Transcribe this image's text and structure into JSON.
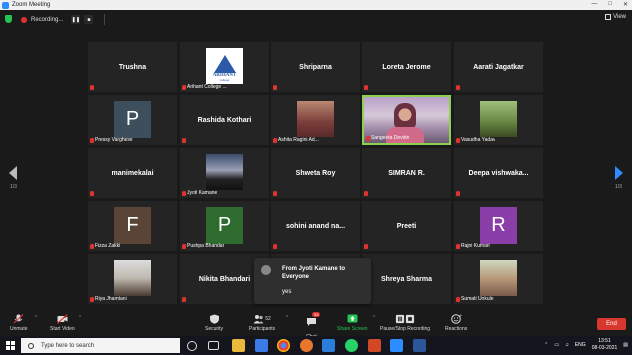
{
  "window": {
    "title": "Zoom Meeting"
  },
  "recording": {
    "label": "Recording..."
  },
  "view_button": {
    "label": "View"
  },
  "pages": {
    "left": "1/3",
    "right": "1/3"
  },
  "participants": [
    {
      "name": "Trushna",
      "label": "",
      "kind": "name"
    },
    {
      "name": "",
      "label": "Arihant College ...",
      "kind": "logo",
      "logo_text": "ARIHANT",
      "logo_sub": "college"
    },
    {
      "name": "Shriparna",
      "label": "",
      "kind": "name"
    },
    {
      "name": "Loreta Jerome",
      "label": "",
      "kind": "name"
    },
    {
      "name": "Aarati Jagatkar",
      "label": "",
      "kind": "name"
    },
    {
      "name": "",
      "label": "Pressy Varghese",
      "kind": "avatar",
      "initial": "P",
      "avatar_color": "#3d4f5c"
    },
    {
      "name": "Rashida Kothari",
      "label": "",
      "kind": "name"
    },
    {
      "name": "",
      "label": "Ashita Ragini Ad...",
      "kind": "photo"
    },
    {
      "name": "",
      "label": "Sangeeta Devidn",
      "kind": "video"
    },
    {
      "name": "",
      "label": "Vasudha Yadav",
      "kind": "photo"
    },
    {
      "name": "manimekalai",
      "label": "",
      "kind": "name"
    },
    {
      "name": "",
      "label": "Jyoti Kamane",
      "kind": "photo"
    },
    {
      "name": "Shweta Roy",
      "label": "",
      "kind": "name"
    },
    {
      "name": "SIMRAN R.",
      "label": "",
      "kind": "name"
    },
    {
      "name": "Deepa  vishwaka...",
      "label": "",
      "kind": "name"
    },
    {
      "name": "",
      "label": "Fizza Zakki",
      "kind": "avatar",
      "initial": "F",
      "avatar_color": "#5a4436"
    },
    {
      "name": "",
      "label": "Pushpa Bhandar",
      "kind": "avatar",
      "initial": "P",
      "avatar_color": "#2e6b2e"
    },
    {
      "name": "sohini anand na...",
      "label": "",
      "kind": "name"
    },
    {
      "name": "Preeti",
      "label": "",
      "kind": "name"
    },
    {
      "name": "",
      "label": "Rajni Kumari",
      "kind": "avatar",
      "initial": "R",
      "avatar_color": "#8a3fa8"
    },
    {
      "name": "",
      "label": "Riya Jhamtani",
      "kind": "photo"
    },
    {
      "name": "Nikita Bhandari",
      "label": "",
      "kind": "name"
    },
    {
      "name": "",
      "label": "",
      "kind": "hidden"
    },
    {
      "name": "Shreya Sharma",
      "label": "",
      "kind": "name"
    },
    {
      "name": "",
      "label": "Sumati Unkule",
      "kind": "photo"
    }
  ],
  "chat_popup": {
    "from": "From Jyoti Kamane to Everyone",
    "message": "yes"
  },
  "toolbar": {
    "unmute": "Unmute",
    "start_video": "Start Video",
    "security": "Security",
    "participants": "Participants",
    "participants_count": "52",
    "chat": "Chat",
    "chat_badge": "33",
    "share_screen": "Share Screen",
    "record": "Pause/Stop Recording",
    "reactions": "Reactions",
    "end": "End"
  },
  "taskbar": {
    "search_placeholder": "Type here to search",
    "language": "ENG",
    "time": "13:51",
    "date": "08-03-2021"
  },
  "colors": {
    "accent": "#2d8cff",
    "share_green": "#23c552",
    "end_red": "#d8372f",
    "active_border": "#8fd14f"
  }
}
